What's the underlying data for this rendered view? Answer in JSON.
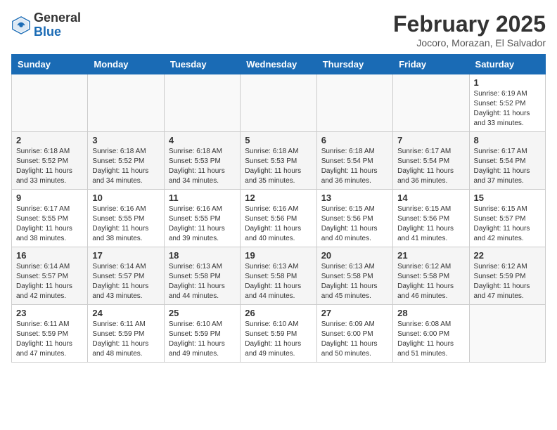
{
  "header": {
    "logo_general": "General",
    "logo_blue": "Blue",
    "title": "February 2025",
    "subtitle": "Jocoro, Morazan, El Salvador"
  },
  "columns": [
    "Sunday",
    "Monday",
    "Tuesday",
    "Wednesday",
    "Thursday",
    "Friday",
    "Saturday"
  ],
  "weeks": [
    {
      "alt": false,
      "days": [
        {
          "num": "",
          "info": ""
        },
        {
          "num": "",
          "info": ""
        },
        {
          "num": "",
          "info": ""
        },
        {
          "num": "",
          "info": ""
        },
        {
          "num": "",
          "info": ""
        },
        {
          "num": "",
          "info": ""
        },
        {
          "num": "1",
          "info": "Sunrise: 6:19 AM\nSunset: 5:52 PM\nDaylight: 11 hours\nand 33 minutes."
        }
      ]
    },
    {
      "alt": true,
      "days": [
        {
          "num": "2",
          "info": "Sunrise: 6:18 AM\nSunset: 5:52 PM\nDaylight: 11 hours\nand 33 minutes."
        },
        {
          "num": "3",
          "info": "Sunrise: 6:18 AM\nSunset: 5:52 PM\nDaylight: 11 hours\nand 34 minutes."
        },
        {
          "num": "4",
          "info": "Sunrise: 6:18 AM\nSunset: 5:53 PM\nDaylight: 11 hours\nand 34 minutes."
        },
        {
          "num": "5",
          "info": "Sunrise: 6:18 AM\nSunset: 5:53 PM\nDaylight: 11 hours\nand 35 minutes."
        },
        {
          "num": "6",
          "info": "Sunrise: 6:18 AM\nSunset: 5:54 PM\nDaylight: 11 hours\nand 36 minutes."
        },
        {
          "num": "7",
          "info": "Sunrise: 6:17 AM\nSunset: 5:54 PM\nDaylight: 11 hours\nand 36 minutes."
        },
        {
          "num": "8",
          "info": "Sunrise: 6:17 AM\nSunset: 5:54 PM\nDaylight: 11 hours\nand 37 minutes."
        }
      ]
    },
    {
      "alt": false,
      "days": [
        {
          "num": "9",
          "info": "Sunrise: 6:17 AM\nSunset: 5:55 PM\nDaylight: 11 hours\nand 38 minutes."
        },
        {
          "num": "10",
          "info": "Sunrise: 6:16 AM\nSunset: 5:55 PM\nDaylight: 11 hours\nand 38 minutes."
        },
        {
          "num": "11",
          "info": "Sunrise: 6:16 AM\nSunset: 5:55 PM\nDaylight: 11 hours\nand 39 minutes."
        },
        {
          "num": "12",
          "info": "Sunrise: 6:16 AM\nSunset: 5:56 PM\nDaylight: 11 hours\nand 40 minutes."
        },
        {
          "num": "13",
          "info": "Sunrise: 6:15 AM\nSunset: 5:56 PM\nDaylight: 11 hours\nand 40 minutes."
        },
        {
          "num": "14",
          "info": "Sunrise: 6:15 AM\nSunset: 5:56 PM\nDaylight: 11 hours\nand 41 minutes."
        },
        {
          "num": "15",
          "info": "Sunrise: 6:15 AM\nSunset: 5:57 PM\nDaylight: 11 hours\nand 42 minutes."
        }
      ]
    },
    {
      "alt": true,
      "days": [
        {
          "num": "16",
          "info": "Sunrise: 6:14 AM\nSunset: 5:57 PM\nDaylight: 11 hours\nand 42 minutes."
        },
        {
          "num": "17",
          "info": "Sunrise: 6:14 AM\nSunset: 5:57 PM\nDaylight: 11 hours\nand 43 minutes."
        },
        {
          "num": "18",
          "info": "Sunrise: 6:13 AM\nSunset: 5:58 PM\nDaylight: 11 hours\nand 44 minutes."
        },
        {
          "num": "19",
          "info": "Sunrise: 6:13 AM\nSunset: 5:58 PM\nDaylight: 11 hours\nand 44 minutes."
        },
        {
          "num": "20",
          "info": "Sunrise: 6:13 AM\nSunset: 5:58 PM\nDaylight: 11 hours\nand 45 minutes."
        },
        {
          "num": "21",
          "info": "Sunrise: 6:12 AM\nSunset: 5:58 PM\nDaylight: 11 hours\nand 46 minutes."
        },
        {
          "num": "22",
          "info": "Sunrise: 6:12 AM\nSunset: 5:59 PM\nDaylight: 11 hours\nand 47 minutes."
        }
      ]
    },
    {
      "alt": false,
      "days": [
        {
          "num": "23",
          "info": "Sunrise: 6:11 AM\nSunset: 5:59 PM\nDaylight: 11 hours\nand 47 minutes."
        },
        {
          "num": "24",
          "info": "Sunrise: 6:11 AM\nSunset: 5:59 PM\nDaylight: 11 hours\nand 48 minutes."
        },
        {
          "num": "25",
          "info": "Sunrise: 6:10 AM\nSunset: 5:59 PM\nDaylight: 11 hours\nand 49 minutes."
        },
        {
          "num": "26",
          "info": "Sunrise: 6:10 AM\nSunset: 5:59 PM\nDaylight: 11 hours\nand 49 minutes."
        },
        {
          "num": "27",
          "info": "Sunrise: 6:09 AM\nSunset: 6:00 PM\nDaylight: 11 hours\nand 50 minutes."
        },
        {
          "num": "28",
          "info": "Sunrise: 6:08 AM\nSunset: 6:00 PM\nDaylight: 11 hours\nand 51 minutes."
        },
        {
          "num": "",
          "info": ""
        }
      ]
    }
  ]
}
